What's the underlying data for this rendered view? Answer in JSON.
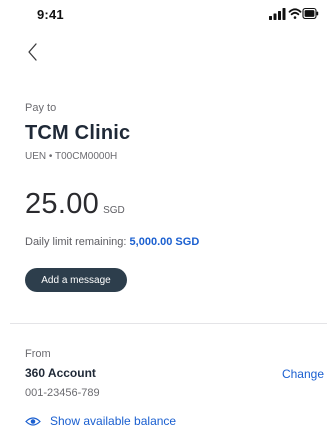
{
  "status_bar": {
    "time": "9:41",
    "icons": [
      "signal-icon",
      "wifi-icon",
      "battery-icon"
    ]
  },
  "nav": {
    "back_icon": "chevron-left-icon"
  },
  "payee": {
    "label": "Pay to",
    "name": "TCM Clinic",
    "uen": "UEN • T00CM0000H"
  },
  "amount": {
    "value": "25.00",
    "currency": "SGD"
  },
  "daily_limit": {
    "label": "Daily limit remaining:",
    "value": "5,000.00 SGD"
  },
  "message": {
    "button_label": "Add a message"
  },
  "source": {
    "label": "From",
    "account_name": "360 Account",
    "account_number": "001-23456-789",
    "change_label": "Change",
    "show_balance_label": "Show available balance",
    "show_balance_icon": "eye-icon"
  },
  "colors": {
    "accent": "#1a5fd0",
    "button_bg": "#2d3e4c",
    "text_primary": "#1f2937",
    "text_secondary": "#6b6b70",
    "divider": "#e4e4e7"
  }
}
